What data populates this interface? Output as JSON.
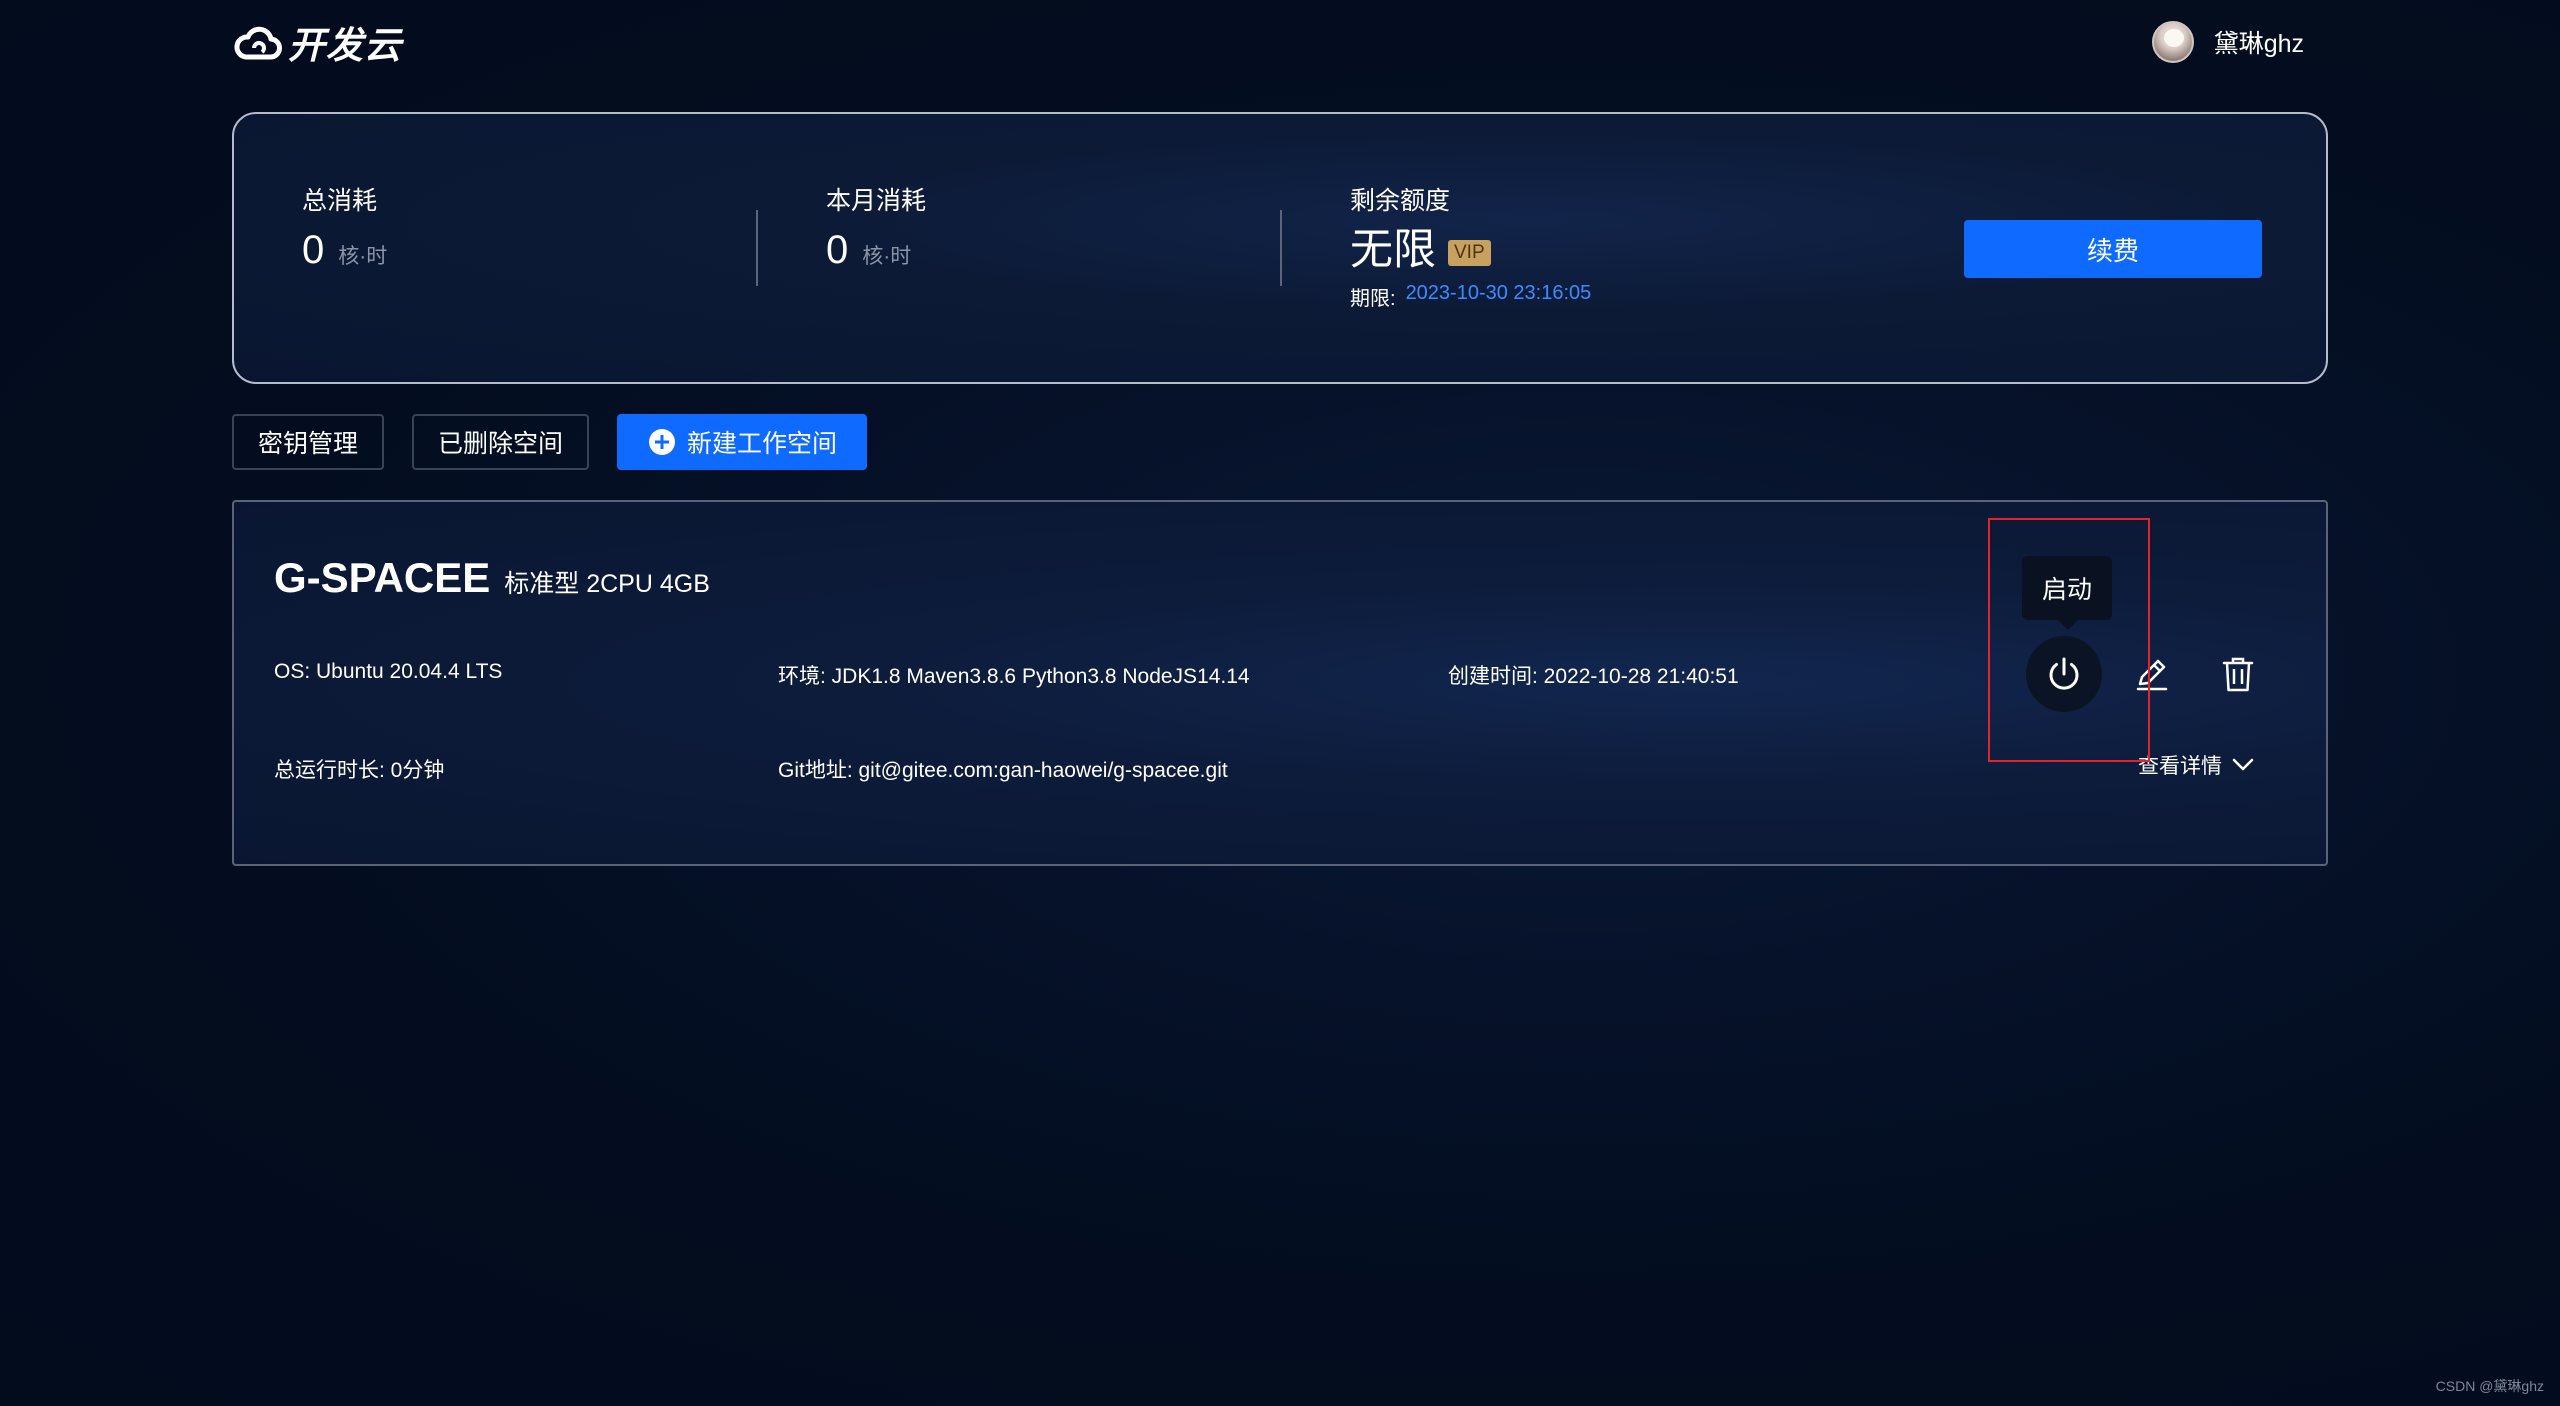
{
  "header": {
    "logo_text": "开发云",
    "username": "黛琳ghz"
  },
  "stats": {
    "total": {
      "label": "总消耗",
      "value": "0",
      "unit": "核·时"
    },
    "month": {
      "label": "本月消耗",
      "value": "0",
      "unit": "核·时"
    },
    "remaining": {
      "label": "剩余额度",
      "value": "无限",
      "badge": "VIP",
      "expire_label": "期限:",
      "expire_date": "2023-10-30 23:16:05"
    },
    "renew_label": "续费"
  },
  "toolbar": {
    "keys_label": "密钥管理",
    "deleted_label": "已删除空间",
    "new_label": "新建工作空间"
  },
  "workspace": {
    "name": "G-SPACEE",
    "spec": "标准型 2CPU 4GB",
    "os": "OS: Ubuntu 20.04.4 LTS",
    "env": "环境: JDK1.8 Maven3.8.6 Python3.8 NodeJS14.14",
    "created": "创建时间: 2022-10-28 21:40:51",
    "runtime": "总运行时长: 0分钟",
    "git": "Git地址: git@gitee.com:gan-haowei/g-spacee.git",
    "tooltip": "启动",
    "details_label": "查看详情"
  },
  "watermark": "CSDN @黛琳ghz",
  "colors": {
    "accent": "#0f6bff",
    "date": "#3c8cff",
    "vip": "#c8a15f",
    "highlight": "#e5232b"
  }
}
